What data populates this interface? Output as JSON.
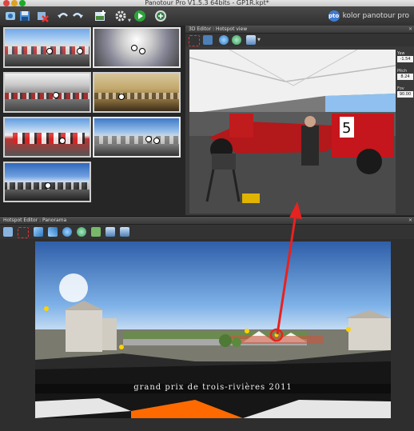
{
  "window": {
    "title": "Panotour Pro V1.5.3 64bits - GP1R.kpt*"
  },
  "brand": {
    "logo_text": "pto",
    "name": "kolor panotour pro"
  },
  "editor3d": {
    "title": "3D Editor : Hotspot view",
    "fields": [
      {
        "label": "Yaw",
        "value": "-1.54"
      },
      {
        "label": "Pitch",
        "value": "8.24"
      },
      {
        "label": "Fov",
        "value": "90.00"
      }
    ],
    "car_number": "5"
  },
  "hotspot_editor": {
    "title": "Hotspot Editor : Panorama",
    "banner_text": "grand prix de trois-rivières 2011"
  },
  "colors": {
    "accent_red": "#e8221e",
    "toolbar_dark": "#303030",
    "sky_top": "#2e5ea8"
  },
  "icons": {
    "toolbar": [
      "new-project-icon",
      "save-icon",
      "close-project-icon",
      "undo-icon",
      "redo-icon",
      "add-panorama-icon",
      "settings-icon",
      "play-icon",
      "publish-icon"
    ],
    "editor3d": [
      "select-tool-icon",
      "frame-icon",
      "hotspot-icon",
      "polygon-hotspot-icon",
      "image-icon"
    ],
    "hotspot_editor": [
      "move-tool-icon",
      "select-tool-icon",
      "arrow-left-icon",
      "arrow-right-icon",
      "spot-icon",
      "add-spot-icon",
      "image-spot-icon",
      "export-icon",
      "import-icon"
    ]
  }
}
